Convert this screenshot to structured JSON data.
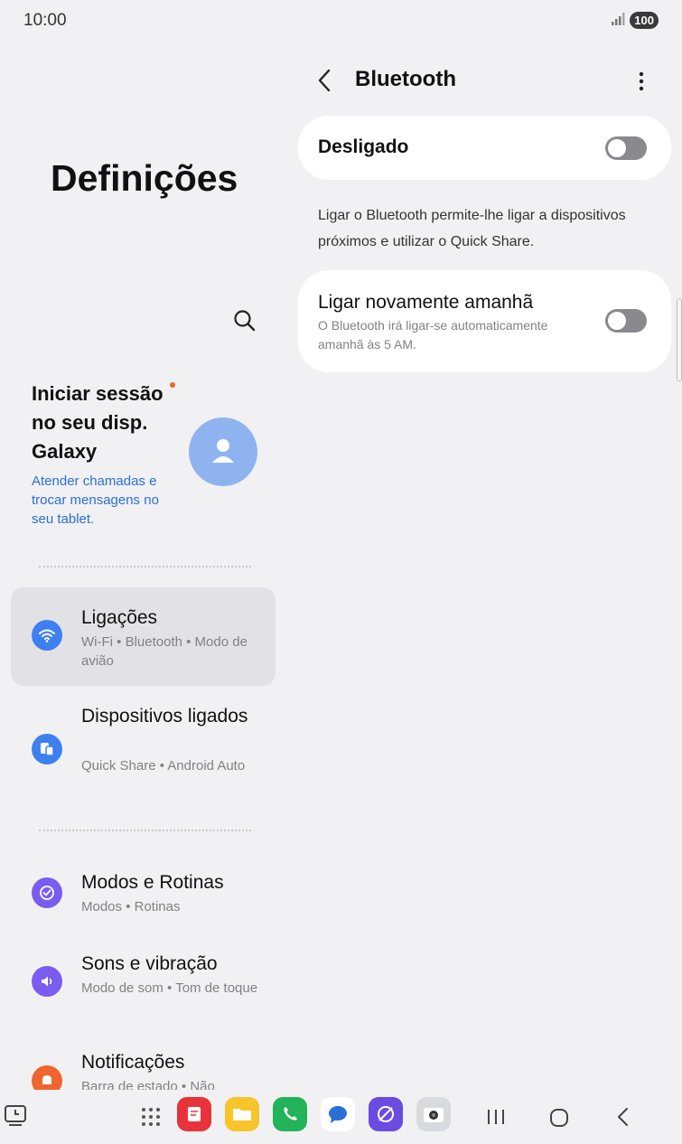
{
  "status_bar": {
    "time": "10:00",
    "battery": "100"
  },
  "left_pane": {
    "title": "Definições",
    "account": {
      "title": "Iniciar sessão no seu disp. Galaxy",
      "subtitle": "Atender chamadas e trocar mensagens no seu tablet."
    },
    "menu": [
      {
        "title": "Ligações",
        "subtitle": "Wi-Fi  •  Bluetooth  •  Modo de avião",
        "icon": "wifi-icon",
        "color": "#3f80f0",
        "selected": true
      },
      {
        "title": "Dispositivos ligados",
        "subtitle": "Quick Share  •  Android Auto",
        "icon": "connected-devices-icon",
        "color": "#3f80f0"
      },
      {
        "title": "Modos e Rotinas",
        "subtitle": "Modos  •  Rotinas",
        "icon": "modes-routines-icon",
        "color": "#7a5cf0"
      },
      {
        "title": "Sons e vibração",
        "subtitle": "Modo de som  •  Tom de toque",
        "icon": "sound-icon",
        "color": "#7a5cf0"
      },
      {
        "title": "Notificações",
        "subtitle": "Barra de estado  •  Não",
        "icon": "bell-icon",
        "color": "#f0652f"
      }
    ]
  },
  "right_pane": {
    "title": "Bluetooth",
    "main_toggle": {
      "label": "Desligado",
      "on": false
    },
    "description": "Ligar o Bluetooth permite-lhe ligar a dispositivos próximos e utilizar o Quick Share.",
    "tomorrow_toggle": {
      "label": "Ligar novamente amanhã",
      "subtitle": "O Bluetooth irá ligar-se automaticamente amanhã às 5 AM.",
      "on": false
    }
  },
  "navbar": {
    "apps": [
      "notes-app-icon",
      "files-app-icon",
      "phone-app-icon",
      "messages-app-icon",
      "internet-app-icon",
      "camera-app-icon"
    ]
  },
  "colors": {
    "accent_blue": "#3f80f0",
    "link_blue": "#2a6fd6",
    "background": "#f1f1f4"
  }
}
